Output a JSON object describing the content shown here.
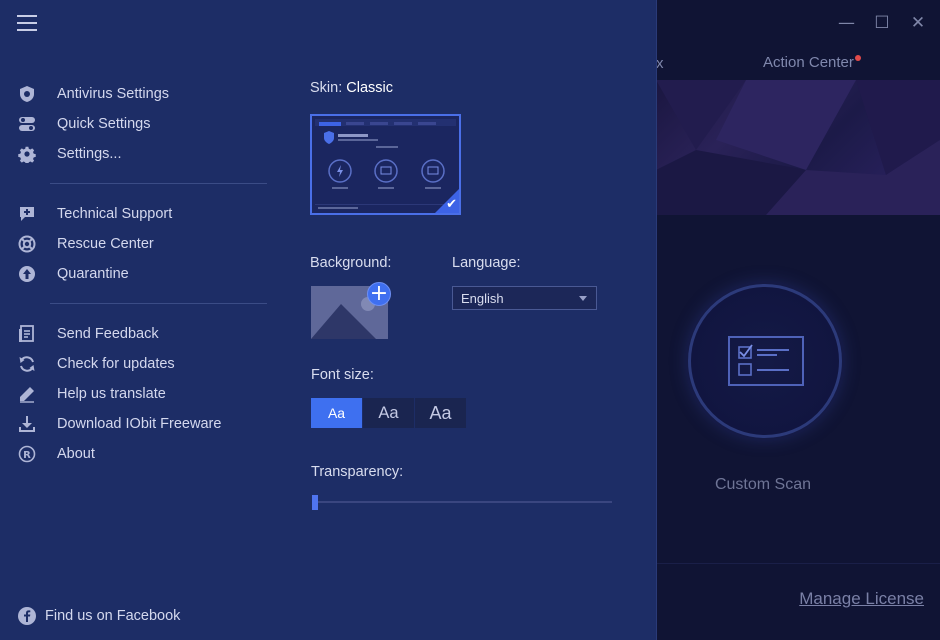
{
  "app": {
    "nav_partial": "x",
    "action_center": "Action Center",
    "custom_scan": "Custom Scan",
    "manage_license": "Manage License",
    "window_controls": {
      "minimize": "—",
      "maximize": "☐",
      "close": "✕"
    }
  },
  "menu": {
    "group1": [
      {
        "label": "Antivirus Settings",
        "icon": "shield-gear-icon"
      },
      {
        "label": "Quick Settings",
        "icon": "toggle-icon"
      },
      {
        "label": "Settings...",
        "icon": "gear-icon"
      }
    ],
    "group2": [
      {
        "label": "Technical Support",
        "icon": "support-chat-icon"
      },
      {
        "label": "Rescue Center",
        "icon": "lifebuoy-icon"
      },
      {
        "label": "Quarantine",
        "icon": "quarantine-icon"
      }
    ],
    "group3": [
      {
        "label": "Send Feedback",
        "icon": "feedback-icon"
      },
      {
        "label": "Check for updates",
        "icon": "refresh-icon"
      },
      {
        "label": "Help us translate",
        "icon": "pencil-icon"
      },
      {
        "label": "Download IObit Freeware",
        "icon": "download-icon"
      },
      {
        "label": "About",
        "icon": "registered-icon"
      }
    ],
    "facebook": "Find us on Facebook"
  },
  "settings": {
    "skin_label": "Skin:",
    "skin_value": "Classic",
    "background_label": "Background:",
    "language_label": "Language:",
    "language_value": "English",
    "font_size_label": "Font size:",
    "font_sizes": [
      "Aa",
      "Aa",
      "Aa"
    ],
    "font_size_selected": 0,
    "transparency_label": "Transparency:",
    "transparency_value": 0
  },
  "colors": {
    "panel_bg": "#1d2d66",
    "accent": "#3e70f0",
    "app_bg": "#101434"
  }
}
